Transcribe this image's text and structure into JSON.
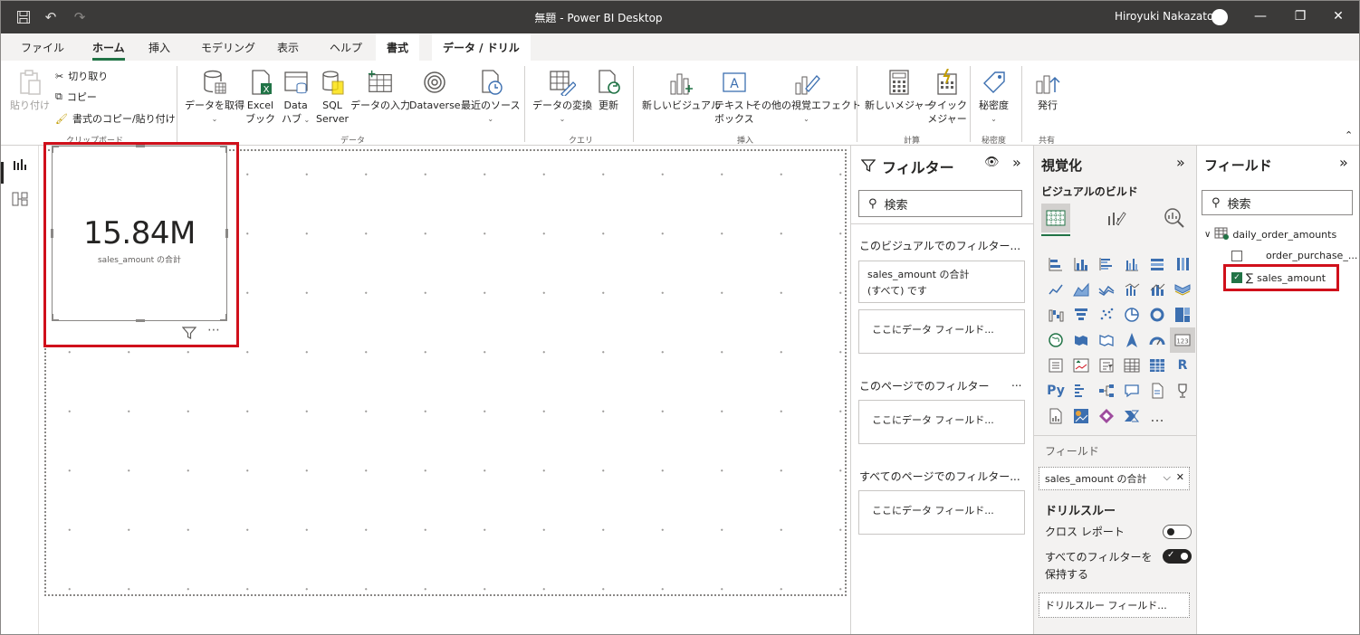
{
  "titlebar": {
    "title": "無題 - Power BI Desktop",
    "user": "Hiroyuki Nakazato"
  },
  "menu": {
    "tabs": [
      "ファイル",
      "ホーム",
      "挿入",
      "モデリング",
      "表示",
      "ヘルプ",
      "書式",
      "データ / ドリル"
    ],
    "active": "ホーム"
  },
  "ribbon": {
    "clipboard": {
      "paste": "貼り付け",
      "cut": "切り取り",
      "copy": "コピー",
      "format_painter": "書式のコピー/貼り付け",
      "group": "クリップボード"
    },
    "data": {
      "get_data": "データを取得",
      "excel_1": "Excel",
      "excel_2": "ブック",
      "hub_1": "Data",
      "hub_2": "ハブ",
      "sql_1": "SQL",
      "sql_2": "Server",
      "enter_data": "データの入力",
      "dataverse": "Dataverse",
      "recent": "最近のソース",
      "group": "データ"
    },
    "query": {
      "transform": "データの変換",
      "refresh": "更新",
      "group": "クエリ"
    },
    "insert": {
      "new_visual": "新しいビジュアル",
      "textbox_1": "テキスト",
      "textbox_2": "ボックス",
      "more_visuals": "その他の視覚エフェクト",
      "group": "挿入"
    },
    "calc": {
      "new_measure": "新しいメジャー",
      "quick_1": "クイック",
      "quick_2": "メジャー",
      "group": "計算"
    },
    "sens": {
      "label": "秘密度",
      "group": "秘密度"
    },
    "share": {
      "publish": "発行",
      "group": "共有"
    }
  },
  "card": {
    "value": "15.84M",
    "label": "sales_amount の合計"
  },
  "filters": {
    "title": "フィルター",
    "search_placeholder": "検索",
    "section_visual": "このビジュアルでのフィルター...",
    "filter_card_line1": "sales_amount の合計",
    "filter_card_line2": "(すべて) です",
    "drop_here": "ここにデータ フィールド...",
    "section_page": "このページでのフィルター",
    "section_all": "すべてのページでのフィルター...",
    "more": "..."
  },
  "viz": {
    "title": "視覚化",
    "build": "ビジュアルのビルド",
    "fields_label": "フィールド",
    "field_value": "sales_amount の合計",
    "drillthrough": "ドリルスルー",
    "cross_report": "クロス レポート",
    "keep_filters_1": "すべてのフィルターを",
    "keep_filters_2": "保持する",
    "drill_drop": "ドリルスルー フィールド...",
    "more": "...",
    "r": "R",
    "py": "Py"
  },
  "fieldpane": {
    "title": "フィールド",
    "search_placeholder": "検索",
    "table": "daily_order_amounts",
    "fields": [
      {
        "name": "order_purchase_...",
        "checked": false
      },
      {
        "name": "sales_amount",
        "checked": true
      }
    ]
  }
}
